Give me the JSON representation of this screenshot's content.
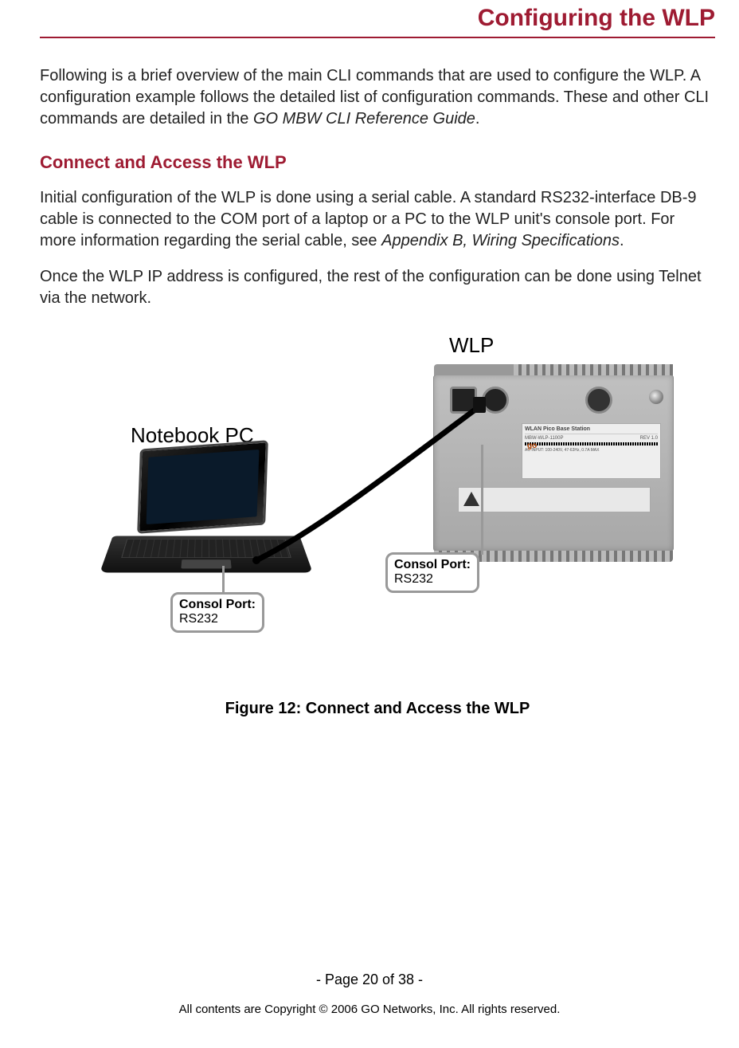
{
  "title": "Configuring the WLP",
  "paragraphs": {
    "p1_a": "Following is a brief overview of the main CLI commands that are used to configure the WLP. A configuration example follows the detailed list of configuration commands. These and other CLI commands are detailed in the ",
    "p1_italic": "GO MBW CLI Reference Guide",
    "p1_b": "."
  },
  "subhead": "Connect and Access the WLP",
  "p2_a": "Initial configuration of the WLP is done using a serial cable. A standard RS232-interface DB-9 cable is connected to the COM port of a laptop or a PC to the WLP unit's console port. For more information regarding the serial cable, see ",
  "p2_italic": "Appendix B, Wiring Specifications",
  "p2_b": ".",
  "p3": "Once the WLP IP address is configured, the rest of the configuration can be done using Telnet via the network.",
  "figure": {
    "wlp_label": "WLP",
    "notebook_label": "Notebook PC",
    "callout1_title": "Consol Port:",
    "callout1_value": "RS232",
    "callout2_title": "Consol Port:",
    "callout2_value": "RS232",
    "device_label_head": "WLAN Pico Base Station",
    "device_model": "MBW-WLP-1100P",
    "device_rev": "REV 1.0",
    "device_input": "AC INPUT: 100-240V, 47-63Hz, 0.7A MAX",
    "device_logo": "go"
  },
  "caption": "Figure 12: Connect and Access the WLP",
  "footer": {
    "page": "- Page 20 of 38 -",
    "copyright": "All contents are Copyright © 2006 GO Networks, Inc. All rights reserved."
  }
}
